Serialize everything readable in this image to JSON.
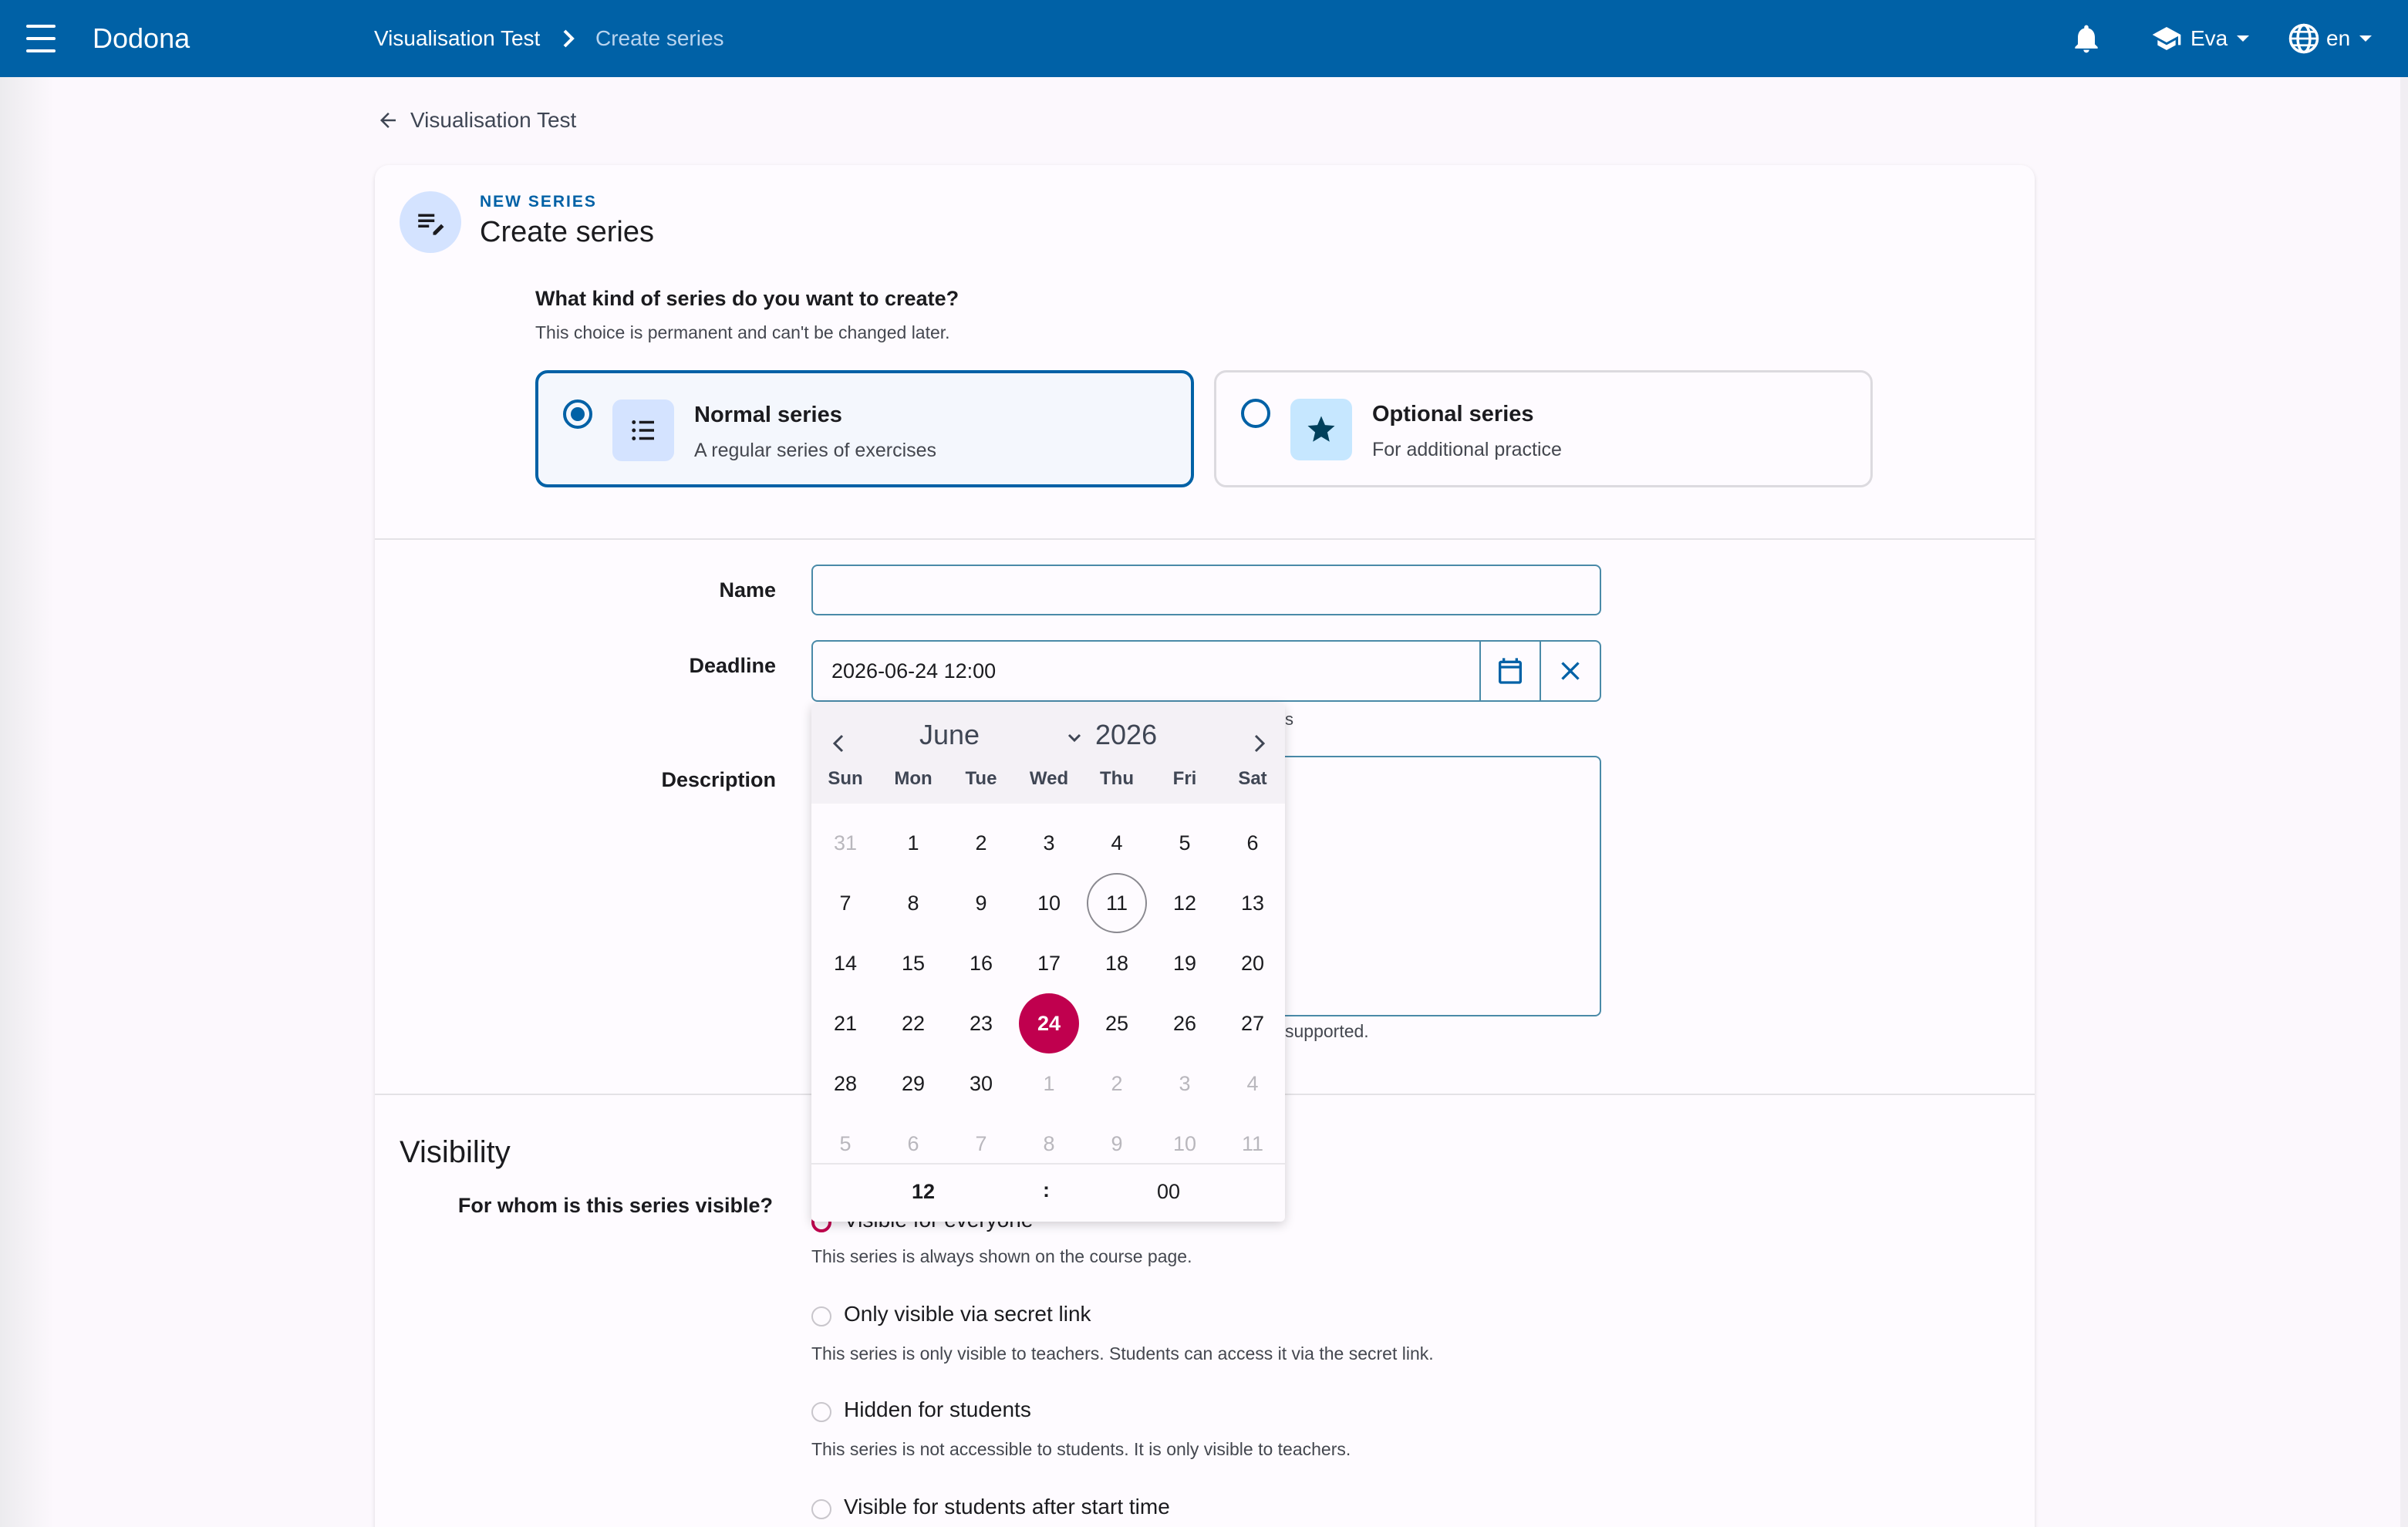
{
  "topbar": {
    "brand": "Dodona",
    "breadcrumb": [
      "Visualisation Test",
      "Create series"
    ],
    "user": "Eva",
    "language": "en"
  },
  "back_link": "Visualisation Test",
  "card": {
    "overline": "NEW SERIES",
    "title": "Create series",
    "question": "What kind of series do you want to create?",
    "question_help": "This choice is permanent and can't be changed later.",
    "choices": [
      {
        "title": "Normal series",
        "subtitle": "A regular series of exercises",
        "selected": true
      },
      {
        "title": "Optional series",
        "subtitle": "For additional practice",
        "selected": false
      }
    ]
  },
  "form": {
    "name_label": "Name",
    "name_value": "",
    "deadline_label": "Deadline",
    "deadline_value": "2026-06-24 12:00",
    "deadline_help_fragment": "s",
    "description_label": "Description",
    "description_help_fragment": "supported."
  },
  "datepicker": {
    "month": "June",
    "year": "2026",
    "weekdays": [
      "Sun",
      "Mon",
      "Tue",
      "Wed",
      "Thu",
      "Fri",
      "Sat"
    ],
    "weeks": [
      [
        "31",
        "1",
        "2",
        "3",
        "4",
        "5",
        "6"
      ],
      [
        "7",
        "8",
        "9",
        "10",
        "11",
        "12",
        "13"
      ],
      [
        "14",
        "15",
        "16",
        "17",
        "18",
        "19",
        "20"
      ],
      [
        "21",
        "22",
        "23",
        "24",
        "25",
        "26",
        "27"
      ],
      [
        "28",
        "29",
        "30",
        "1",
        "2",
        "3",
        "4"
      ],
      [
        "5",
        "6",
        "7",
        "8",
        "9",
        "10",
        "11"
      ]
    ],
    "today": "11",
    "selected": "24",
    "hour": "12",
    "separator": ":",
    "minute": "00"
  },
  "visibility": {
    "title": "Visibility",
    "question": "For whom is this series visible?",
    "options": [
      {
        "label": "Visible for everyone",
        "help": "This series is always shown on the course page."
      },
      {
        "label": "Only visible via secret link",
        "help": "This series is only visible to teachers. Students can access it via the secret link."
      },
      {
        "label": "Hidden for students",
        "help": "This series is not accessible to students. It is only visible to teachers."
      },
      {
        "label": "Visible for students after start time",
        "help": ""
      }
    ]
  },
  "colors": {
    "primary": "#0061a6",
    "selected_day": "#c0004e",
    "topbar": "#0061a6"
  }
}
